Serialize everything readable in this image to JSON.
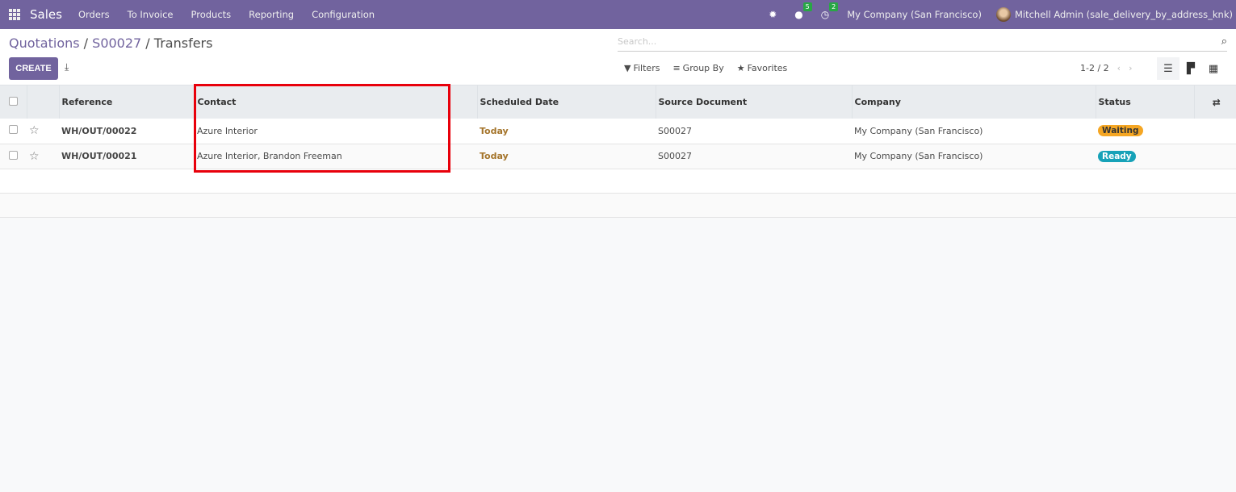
{
  "navbar": {
    "app_name": "Sales",
    "menu": [
      "Orders",
      "To Invoice",
      "Products",
      "Reporting",
      "Configuration"
    ],
    "messages_count": "5",
    "activities_count": "2",
    "company": "My Company (San Francisco)",
    "user": "Mitchell Admin (sale_delivery_by_address_knk)",
    "icons": {
      "apps": "grid-icon",
      "debug": "bug-icon",
      "messages": "chat-icon",
      "activities": "clock-icon"
    }
  },
  "control": {
    "breadcrumb": [
      "Quotations",
      "S00027",
      "Transfers"
    ],
    "separator": " / ",
    "create_label": "CREATE",
    "search_placeholder": "Search...",
    "filters_label": "Filters",
    "groupby_label": "Group By",
    "favorites_label": "Favorites",
    "pager": "1-2 / 2",
    "views": [
      "list",
      "kanban",
      "calendar"
    ],
    "active_view": "list"
  },
  "table": {
    "columns": [
      "Reference",
      "Contact",
      "Scheduled Date",
      "Source Document",
      "Company",
      "Status"
    ],
    "rows": [
      {
        "reference": "WH/OUT/00022",
        "contact": "Azure Interior",
        "scheduled_date": "Today",
        "source_document": "S00027",
        "company": "My Company (San Francisco)",
        "status": "Waiting"
      },
      {
        "reference": "WH/OUT/00021",
        "contact": "Azure Interior, Brandon Freeman",
        "scheduled_date": "Today",
        "source_document": "S00027",
        "company": "My Company (San Francisco)",
        "status": "Ready"
      }
    ]
  },
  "colors": {
    "brand": "#71639e",
    "waiting": "#f5a623",
    "ready": "#17a2b8",
    "highlight": "#e8000b",
    "date": "#a4742a"
  }
}
